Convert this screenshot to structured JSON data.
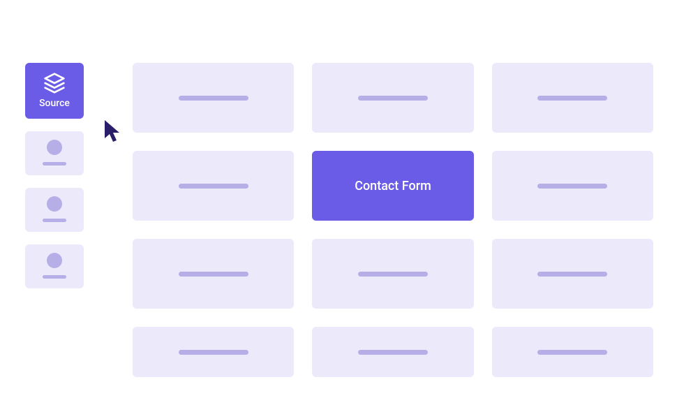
{
  "sidebar": {
    "items": [
      {
        "label": "Source",
        "icon": "layers-icon",
        "active": true
      },
      {
        "icon": "avatar-icon",
        "active": false
      },
      {
        "icon": "avatar-icon",
        "active": false
      },
      {
        "icon": "avatar-icon",
        "active": false
      }
    ]
  },
  "grid": {
    "cards": [
      {
        "selected": false
      },
      {
        "selected": false
      },
      {
        "selected": false
      },
      {
        "selected": false
      },
      {
        "label": "Contact Form",
        "selected": true
      },
      {
        "selected": false
      },
      {
        "selected": false
      },
      {
        "selected": false
      },
      {
        "selected": false
      },
      {
        "selected": false
      },
      {
        "selected": false
      },
      {
        "selected": false
      }
    ]
  },
  "colors": {
    "accent": "#6b5ce7",
    "panel": "#ece9fb",
    "muted": "#b6aee6",
    "cursor": "#2a1e6b"
  }
}
